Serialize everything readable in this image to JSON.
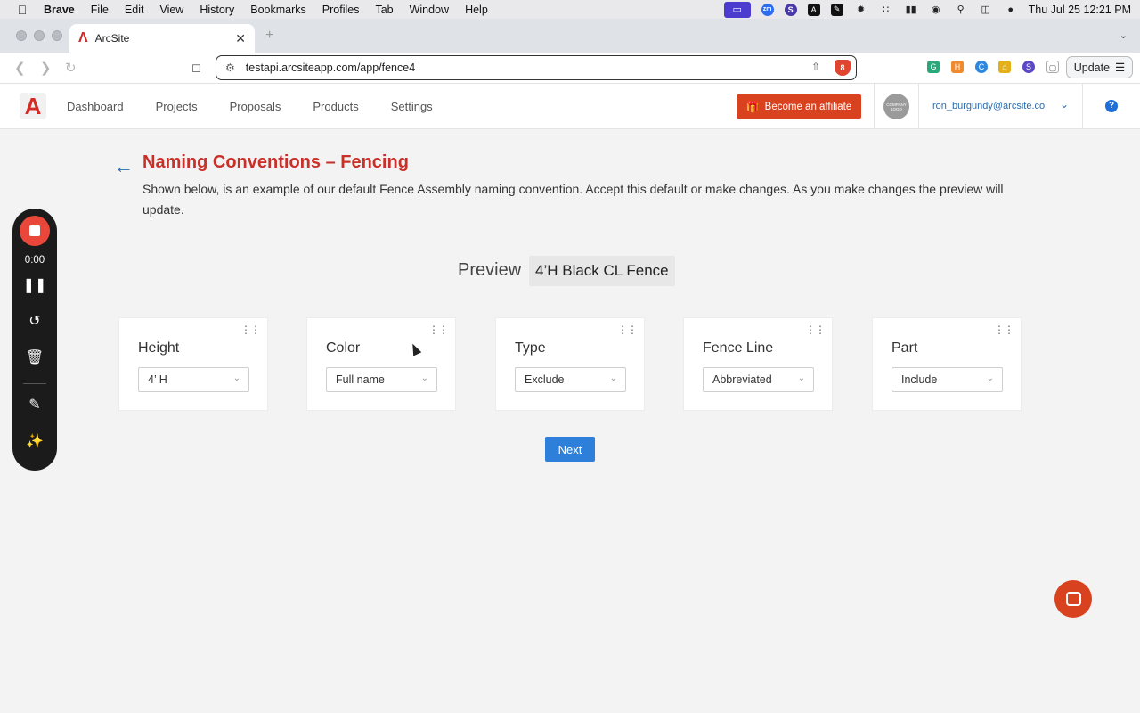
{
  "menubar": {
    "app_name": "Brave",
    "items": [
      "File",
      "Edit",
      "View",
      "History",
      "Bookmarks",
      "Profiles",
      "Tab",
      "Window",
      "Help"
    ],
    "clock": "Thu Jul 25  12:21 PM"
  },
  "browser": {
    "tab_title": "ArcSite",
    "url": "testapi.arcsiteapp.com/app/fence4",
    "update_label": "Update",
    "shield_count": "8"
  },
  "app": {
    "logo_letter": "A",
    "nav": [
      "Dashboard",
      "Projects",
      "Proposals",
      "Products",
      "Settings"
    ],
    "affiliate_label": "Become an affiliate",
    "company_logo_text": "COMPANY LOGO",
    "user_email": "ron_burgundy@arcsite.co",
    "help_glyph": "?"
  },
  "page": {
    "title": "Naming Conventions – Fencing",
    "description": "Shown below, is an example of our default Fence Assembly naming convention. Accept this default or make changes. As you make changes the preview will update.",
    "preview_label": "Preview",
    "preview_value": "4’H Black CL Fence",
    "next_label": "Next"
  },
  "cards": [
    {
      "title": "Height",
      "value": "4’ H"
    },
    {
      "title": "Color",
      "value": "Full name"
    },
    {
      "title": "Type",
      "value": "Exclude"
    },
    {
      "title": "Fence Line",
      "value": "Abbreviated"
    },
    {
      "title": "Part",
      "value": "Include"
    }
  ],
  "recorder": {
    "time": "0:00"
  },
  "colors": {
    "brand_red": "#c8302a",
    "affiliate_orange": "#d9421f",
    "primary_blue": "#2e7fd9"
  }
}
